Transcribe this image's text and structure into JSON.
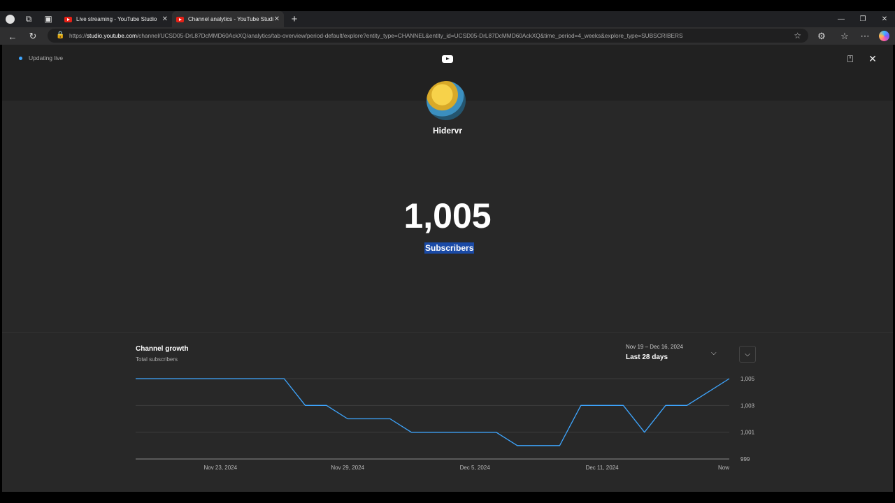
{
  "browser": {
    "tabs": [
      {
        "label": "Live streaming - YouTube Studio"
      },
      {
        "label": "Channel analytics - YouTube Studi"
      }
    ],
    "url_prefix": "https://",
    "url_host": "studio.youtube.com",
    "url_path": "/channel/UCSD05-DrL87DcMMD60AckXQ/analytics/tab-overview/period-default/explore?entity_type=CHANNEL&entity_id=UCSD05-DrL87DcMMD60AckXQ&time_period=4_weeks&explore_type=SUBSCRIBERS"
  },
  "header": {
    "status": "Updating live"
  },
  "channel": {
    "name": "Hidervr",
    "subscriber_count": "1,005",
    "subscriber_label": "Subscribers"
  },
  "growth": {
    "title": "Channel growth",
    "subtitle": "Total subscribers",
    "date_range": "Nov 19 – Dec 16, 2024",
    "period": "Last 28 days"
  },
  "chart_data": {
    "type": "line",
    "title": "Channel growth",
    "subtitle": "Total subscribers",
    "x_tick_labels": [
      "Nov 23, 2024",
      "Nov 29, 2024",
      "Dec 5, 2024",
      "Dec 11, 2024",
      "Now"
    ],
    "x_tick_days": [
      4,
      10,
      16,
      22,
      28
    ],
    "y_tick_labels": [
      "1,005",
      "1,003",
      "1,001",
      "999"
    ],
    "y_ticks": [
      1005,
      1003,
      1001,
      999
    ],
    "ylim": [
      999,
      1005
    ],
    "xlim": [
      0,
      28
    ],
    "grid": true,
    "color": "#3ea6ff",
    "series": [
      {
        "x": [
          0,
          1,
          2,
          3,
          4,
          5,
          6,
          7,
          8,
          9,
          10,
          11,
          12,
          13,
          14,
          15,
          16,
          17,
          18,
          19,
          20,
          21,
          22,
          23,
          24,
          25,
          26,
          27,
          28
        ],
        "y": [
          1005,
          1005,
          1005,
          1005,
          1005,
          1005,
          1005,
          1005,
          1003,
          1003,
          1002,
          1002,
          1002,
          1001,
          1001,
          1001,
          1001,
          1001,
          1000,
          1000,
          1000,
          1003,
          1003,
          1003,
          1001,
          1003,
          1003,
          1004,
          1005
        ]
      }
    ]
  }
}
